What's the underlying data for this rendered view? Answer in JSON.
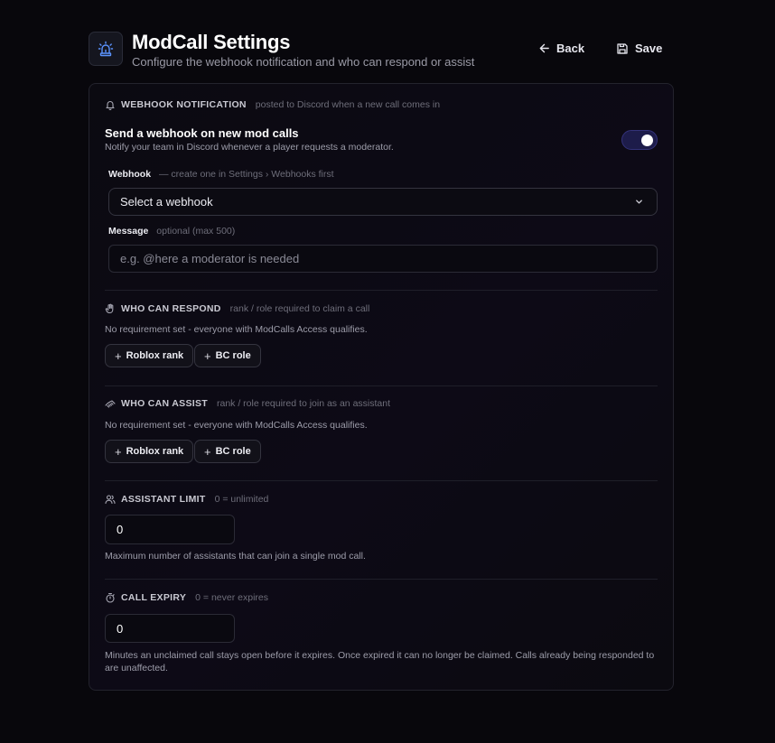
{
  "header": {
    "title": "ModCall Settings",
    "subtitle": "Configure the webhook notification and who can respond or assist",
    "back_label": "Back",
    "save_label": "Save"
  },
  "webhook_section": {
    "title": "WEBHOOK NOTIFICATION",
    "hint": "posted to Discord when a new call comes in",
    "toggle_title": "Send a webhook on new mod calls",
    "toggle_desc": "Notify your team in Discord whenever a player requests a moderator.",
    "toggle_on": true,
    "webhook_label": "Webhook",
    "webhook_hint": "— create one in Settings › Webhooks first",
    "webhook_selected": "Select a webhook",
    "message_label": "Message",
    "message_hint": "optional (max 500)",
    "message_placeholder": "e.g. @here a moderator is needed",
    "message_value": ""
  },
  "respond_section": {
    "title": "WHO CAN RESPOND",
    "hint": "rank / role required to claim a call",
    "desc": "No requirement set - everyone with ModCalls Access qualifies.",
    "roblox_rank_label": "Roblox rank",
    "bc_role_label": "BC role"
  },
  "assist_section": {
    "title": "WHO CAN ASSIST",
    "hint": "rank / role required to join as an assistant",
    "desc": "No requirement set - everyone with ModCalls Access qualifies.",
    "roblox_rank_label": "Roblox rank",
    "bc_role_label": "BC role"
  },
  "assistant_limit": {
    "title": "ASSISTANT LIMIT",
    "hint": "0 = unlimited",
    "value": "0",
    "desc": "Maximum number of assistants that can join a single mod call."
  },
  "call_expiry": {
    "title": "CALL EXPIRY",
    "hint": "0 = never expires",
    "value": "0",
    "desc_line1": "Minutes an unclaimed call stays open before it expires. Once expired it can no longer be claimed. Calls already being responded to",
    "desc_line2": "are unaffected."
  },
  "colors": {
    "background": "#08070c",
    "accent": "#4f8cff",
    "toggle_track": "#1d1c4a"
  }
}
